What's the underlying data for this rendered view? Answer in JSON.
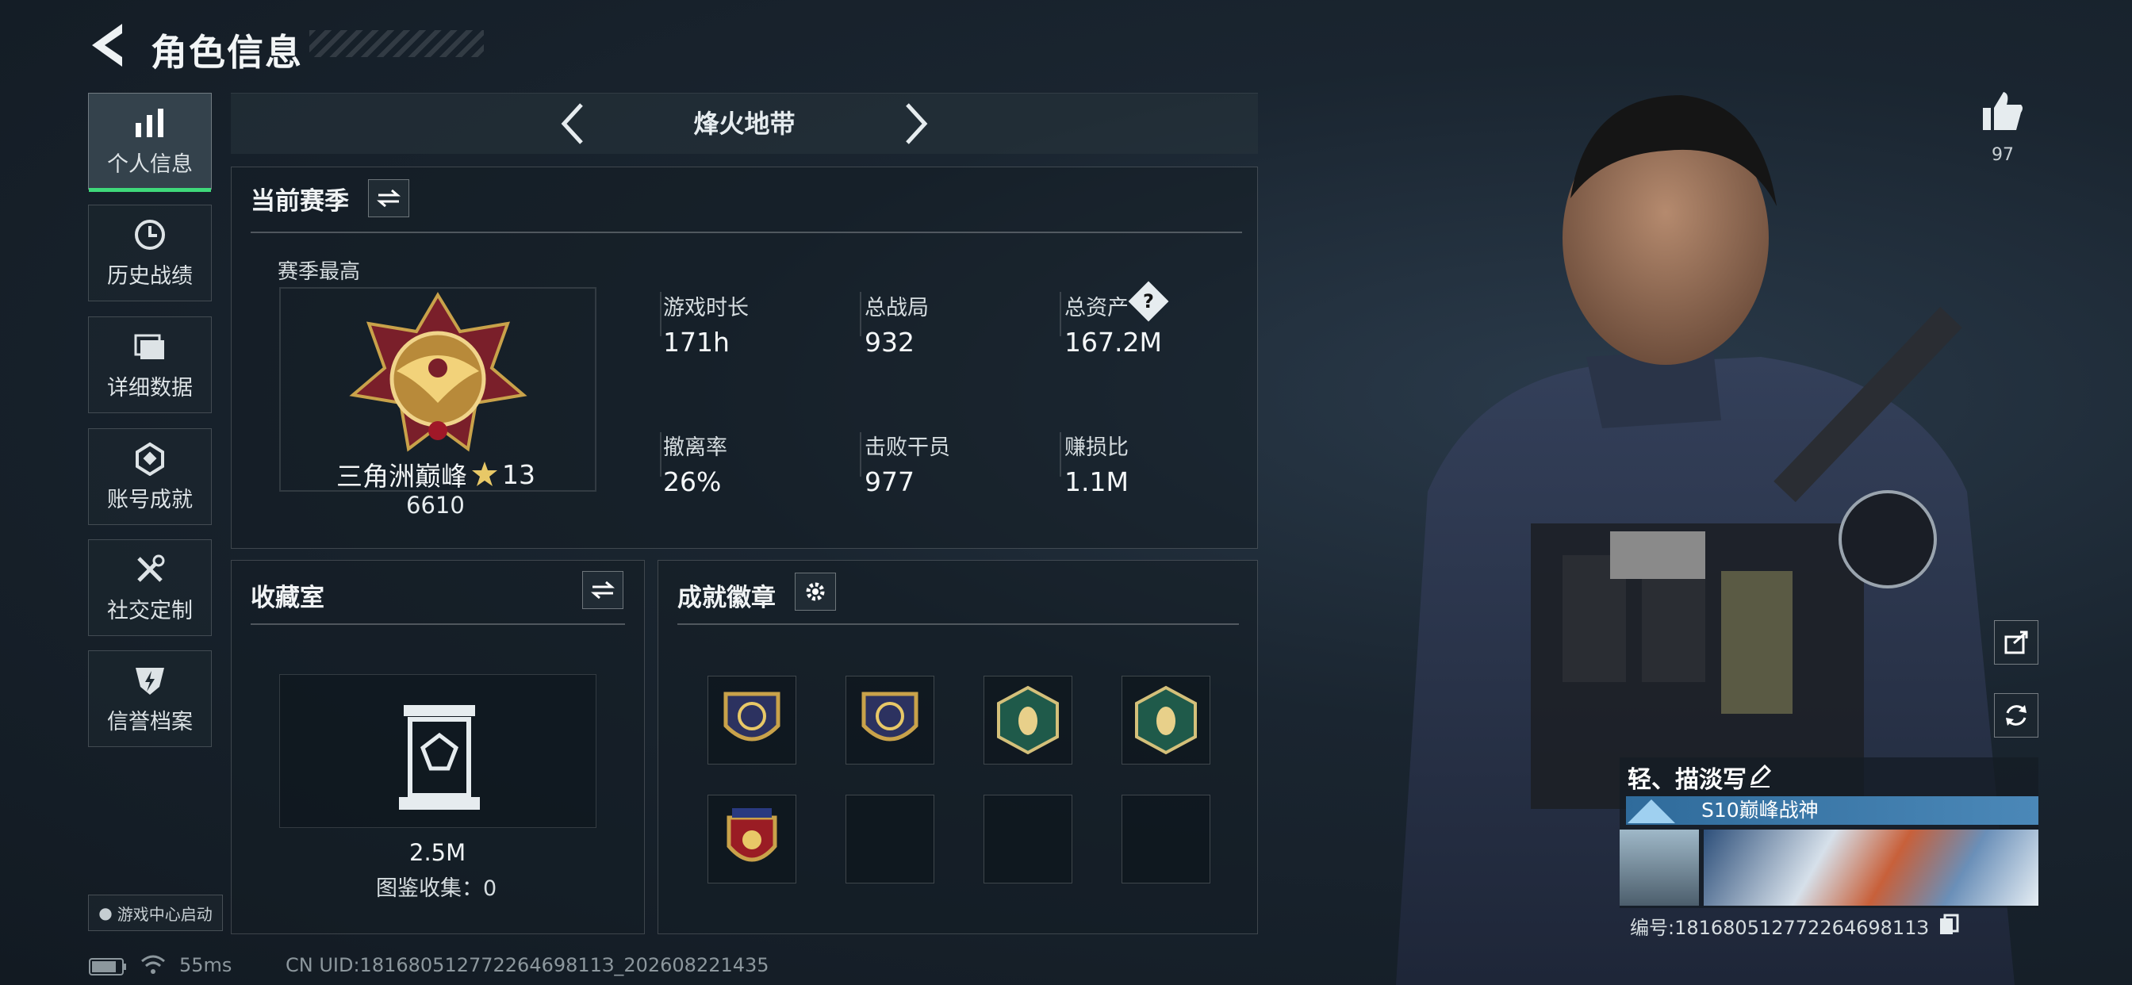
{
  "header": {
    "title": "角色信息"
  },
  "sidebar": {
    "items": [
      {
        "label": "个人信息",
        "icon": "bar-chart-icon",
        "active": true
      },
      {
        "label": "历史战绩",
        "icon": "history-clock-icon"
      },
      {
        "label": "详细数据",
        "icon": "folder-icon"
      },
      {
        "label": "账号成就",
        "icon": "achievement-icon"
      },
      {
        "label": "社交定制",
        "icon": "tools-icon"
      },
      {
        "label": "信誉档案",
        "icon": "credit-shield-icon"
      }
    ],
    "game_center": "游戏中心启动"
  },
  "mode": {
    "name": "烽火地带"
  },
  "season": {
    "title": "当前赛季",
    "best_label": "赛季最高",
    "rank_name": "三角洲巅峰",
    "rank_stars": "13",
    "rank_score": "6610",
    "stats": [
      {
        "label": "游戏时长",
        "value": "171h"
      },
      {
        "label": "总战局",
        "value": "932"
      },
      {
        "label": "总资产",
        "value": "167.2M",
        "help": "?"
      },
      {
        "label": "撤离率",
        "value": "26%"
      },
      {
        "label": "击败干员",
        "value": "977"
      },
      {
        "label": "赚损比",
        "value": "1.1M"
      }
    ]
  },
  "collection": {
    "title": "收藏室",
    "value": "2.5M",
    "catalog": "图鉴收集：0"
  },
  "badges": {
    "title": "成就徽章"
  },
  "player": {
    "likes": "97",
    "name": "轻、描淡写",
    "card_title": "S10巅峰战神",
    "id_line": "编号:18168051277226469811З"
  },
  "footer": {
    "ping": "55ms",
    "uid": "CN UID:18168051277226469811З_202608221435"
  },
  "colors": {
    "accent": "#3fd97a",
    "panel_border": "#3a4650",
    "title_bar": "#3c7aab"
  }
}
